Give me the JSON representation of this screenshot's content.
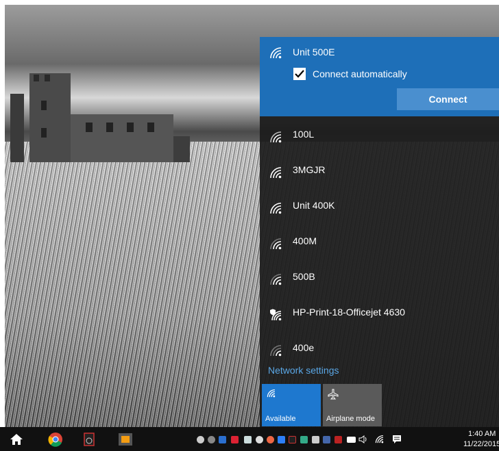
{
  "flyout": {
    "selected_network": {
      "name": "Unit 500E",
      "connect_automatically_label": "Connect automatically",
      "connect_automatically_checked": true,
      "connect_button_label": "Connect"
    },
    "networks": [
      {
        "name": "100L",
        "secured": false
      },
      {
        "name": "3MGJR",
        "secured": false
      },
      {
        "name": "Unit 400K",
        "secured": false
      },
      {
        "name": "400M",
        "secured": false
      },
      {
        "name": "500B",
        "secured": false
      },
      {
        "name": "HP-Print-18-Officejet 4630",
        "secured": true
      },
      {
        "name": "400e",
        "secured": false
      }
    ],
    "network_settings_label": "Network settings",
    "tiles": {
      "wifi_label": "Available",
      "airplane_label": "Airplane mode"
    }
  },
  "taskbar": {
    "clock_time": "1:40 AM",
    "clock_date": "11/22/2015"
  },
  "colors": {
    "accent": "#1e6fb8",
    "connect_button": "#4a8fcf",
    "link": "#5aa7e6",
    "flyout_bg": "#1c1c1c"
  },
  "icons": [
    "start-icon",
    "chrome-icon",
    "clock-app-icon",
    "sublime-icon",
    "wifi-icon",
    "airplane-icon",
    "volume-icon",
    "battery-icon",
    "notification-icon"
  ]
}
